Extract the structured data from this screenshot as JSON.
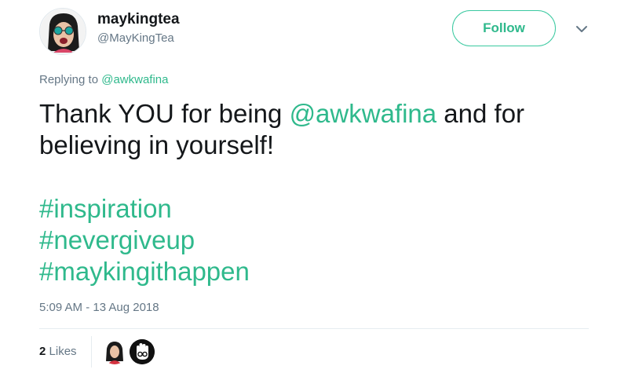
{
  "tweet": {
    "display_name": "maykingtea",
    "handle": "@MayKingTea",
    "follow_label": "Follow",
    "replying_prefix": "Replying to",
    "replying_to": "@awkwafina",
    "text_part1": "Thank YOU for being ",
    "text_mention": "@awkwafina",
    "text_part2": " and for believing in yourself!",
    "hashtags": [
      "#inspiration",
      "#nevergiveup",
      "#maykingithappen"
    ],
    "timestamp": "5:09 AM - 13 Aug 2018",
    "likes_count": "2",
    "likes_label": "Likes"
  },
  "colors": {
    "accent": "#2fb98c",
    "text": "#14171a",
    "muted": "#657786"
  },
  "icons": {
    "caret": "chevron-down-icon",
    "liker1": "avatar",
    "liker2": "avatar"
  }
}
